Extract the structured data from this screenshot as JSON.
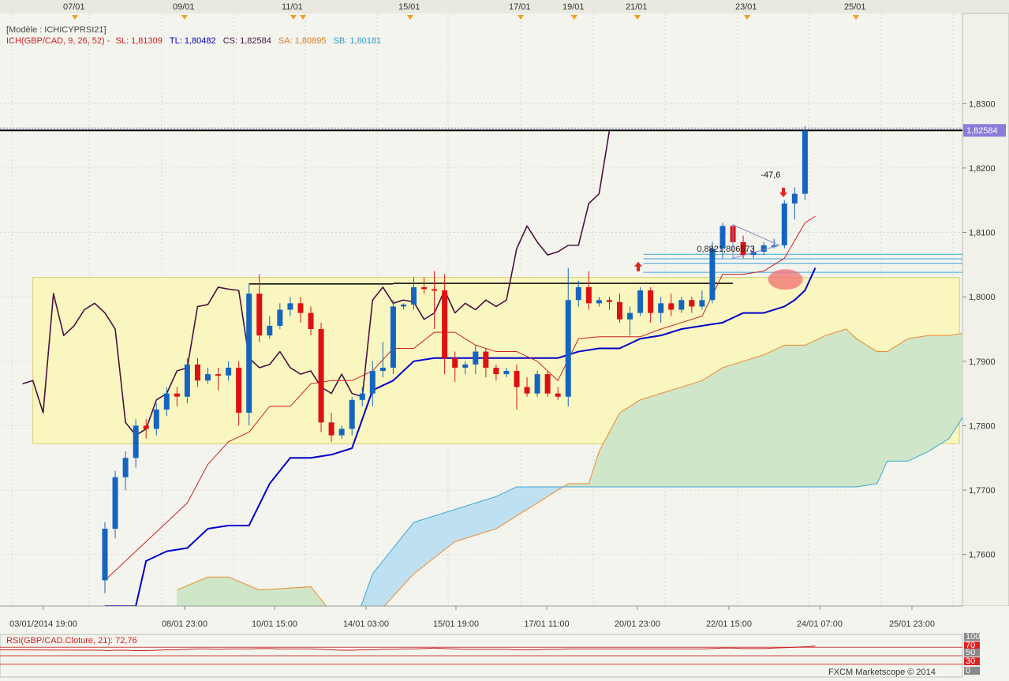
{
  "header": {
    "model_text": "[Modèle : ICHICYPRSI21]",
    "ich_label": "ICH(GBP/CAD, 9, 26, 52) -",
    "sl": "SL: 1,81309",
    "tl": "TL: 1,80482",
    "cs": "CS: 1,82584",
    "sa": "SA: 1,80895",
    "sb": "SB: 1,80181"
  },
  "rsi": {
    "label": "RSI(GBP/CAD.Cloture, 21): 72,76",
    "axis": [
      "100",
      "70",
      "50",
      "30",
      "0"
    ],
    "levels": [
      70,
      50,
      30
    ]
  },
  "footer": {
    "brand": "FXCM Marketscope © 2014"
  },
  "annotations": {
    "pips": "-47,6",
    "levels_text": "0,8821,806573"
  },
  "colors": {
    "background": "#f4f4ee",
    "bull": "#1565c0",
    "bear": "#dd1111",
    "tenkan": "#cc2222",
    "kijun": "#0000cc",
    "chikou": "#4a1040",
    "senkou_a": "#f08a30",
    "senkou_b": "#3aa6d8",
    "kumo_bull": "#bfe0f0",
    "kumo_bear": "#cfe6c8",
    "zone": "#faf6c0",
    "price_tag": "#8a7cdc"
  },
  "chart_data": {
    "type": "candlestick",
    "symbol": "GBP/CAD",
    "last_price": "1,82584",
    "ylim": [
      1.752,
      1.844
    ],
    "yticks": [
      "1,7600",
      "1,7700",
      "1,7800",
      "1,7900",
      "1,8000",
      "1,8100",
      "1,8200",
      "1,8300"
    ],
    "x_labels_bottom": [
      "03/01/2014 19:00",
      "08/01 23:00",
      "10/01 15:00",
      "14/01 03:00",
      "15/01 19:00",
      "17/01 11:00",
      "20/01 23:00",
      "22/01 15:00",
      "24/01 07:00",
      "25/01 23:00"
    ],
    "x_labels_top": [
      "07/01",
      "09/01",
      "11/01",
      "15/01",
      "17/01",
      "19/01",
      "21/01",
      "23/01",
      "25/01"
    ],
    "candles": [
      [
        1.756,
        1.764,
        1.754,
        1.765
      ],
      [
        1.764,
        1.772,
        1.7625,
        1.773
      ],
      [
        1.772,
        1.775,
        1.77,
        1.776
      ],
      [
        1.775,
        1.78,
        1.7735,
        1.781
      ],
      [
        1.78,
        1.7795,
        1.778,
        1.781
      ],
      [
        1.7795,
        1.7825,
        1.7785,
        1.7835
      ],
      [
        1.7825,
        1.785,
        1.7815,
        1.786
      ],
      [
        1.785,
        1.7845,
        1.783,
        1.786
      ],
      [
        1.7845,
        1.7895,
        1.7835,
        1.7905
      ],
      [
        1.7895,
        1.787,
        1.786,
        1.7905
      ],
      [
        1.787,
        1.788,
        1.7865,
        1.789
      ],
      [
        1.788,
        1.7878,
        1.7855,
        1.789
      ],
      [
        1.7878,
        1.789,
        1.787,
        1.79
      ],
      [
        1.789,
        1.782,
        1.78,
        1.79
      ],
      [
        1.782,
        1.8005,
        1.78,
        1.802
      ],
      [
        1.8005,
        1.794,
        1.793,
        1.8035
      ],
      [
        1.794,
        1.7955,
        1.7935,
        1.797
      ],
      [
        1.7955,
        1.798,
        1.795,
        1.799
      ],
      [
        1.798,
        1.799,
        1.797,
        1.8
      ],
      [
        1.799,
        1.7975,
        1.796,
        1.8
      ],
      [
        1.7975,
        1.795,
        1.794,
        1.7985
      ],
      [
        1.795,
        1.7805,
        1.779,
        1.796
      ],
      [
        1.7805,
        1.7785,
        1.7775,
        1.782
      ],
      [
        1.7785,
        1.7795,
        1.778,
        1.78
      ],
      [
        1.7795,
        1.784,
        1.7785,
        1.7845
      ],
      [
        1.784,
        1.785,
        1.783,
        1.786
      ],
      [
        1.785,
        1.7885,
        1.783,
        1.79
      ],
      [
        1.7885,
        1.789,
        1.7875,
        1.793
      ],
      [
        1.789,
        1.7985,
        1.788,
        1.7995
      ],
      [
        1.7985,
        1.7988,
        1.798,
        1.799
      ],
      [
        1.7988,
        1.8015,
        1.798,
        1.803
      ],
      [
        1.8015,
        1.8012,
        1.8005,
        1.803
      ],
      [
        1.8012,
        1.801,
        1.795,
        1.804
      ],
      [
        1.801,
        1.7905,
        1.788,
        1.8035
      ],
      [
        1.7905,
        1.789,
        1.7868,
        1.7915
      ],
      [
        1.789,
        1.7895,
        1.788,
        1.79
      ],
      [
        1.7895,
        1.7915,
        1.788,
        1.7925
      ],
      [
        1.7915,
        1.789,
        1.7875,
        1.792
      ],
      [
        1.789,
        1.788,
        1.787,
        1.7895
      ],
      [
        1.788,
        1.7885,
        1.7875,
        1.789
      ],
      [
        1.7885,
        1.786,
        1.7825,
        1.7895
      ],
      [
        1.786,
        1.785,
        1.7845,
        1.7875
      ],
      [
        1.785,
        1.788,
        1.7845,
        1.7885
      ],
      [
        1.788,
        1.785,
        1.7845,
        1.7885
      ],
      [
        1.785,
        1.7845,
        1.784,
        1.786
      ],
      [
        1.7845,
        1.7995,
        1.783,
        1.8045
      ],
      [
        1.7995,
        1.8015,
        1.7985,
        1.8025
      ],
      [
        1.8015,
        1.799,
        1.798,
        1.804
      ],
      [
        1.799,
        1.7995,
        1.7985,
        1.8
      ],
      [
        1.7995,
        1.7992,
        1.798,
        1.8
      ],
      [
        1.7992,
        1.7965,
        1.796,
        1.8005
      ],
      [
        1.7965,
        1.7975,
        1.794,
        1.7985
      ],
      [
        1.7975,
        1.801,
        1.797,
        1.8015
      ],
      [
        1.801,
        1.7975,
        1.796,
        1.8015
      ],
      [
        1.7975,
        1.799,
        1.796,
        1.8
      ],
      [
        1.799,
        1.798,
        1.797,
        1.8005
      ],
      [
        1.798,
        1.7995,
        1.7975,
        1.8
      ],
      [
        1.7995,
        1.7985,
        1.7975,
        1.8
      ],
      [
        1.7985,
        1.7995,
        1.798,
        1.801
      ],
      [
        1.7995,
        1.8075,
        1.799,
        1.8085
      ],
      [
        1.8075,
        1.811,
        1.806,
        1.8115
      ],
      [
        1.811,
        1.8085,
        1.8075,
        1.8112
      ],
      [
        1.8085,
        1.8065,
        1.806,
        1.8095
      ],
      [
        1.8065,
        1.807,
        1.806,
        1.808
      ],
      [
        1.807,
        1.808,
        1.8065,
        1.8085
      ],
      [
        1.808,
        1.808,
        1.8075,
        1.809
      ],
      [
        1.808,
        1.8145,
        1.8075,
        1.815
      ],
      [
        1.8145,
        1.816,
        1.812,
        1.817
      ],
      [
        1.816,
        1.8258,
        1.815,
        1.8265
      ]
    ],
    "tenkan": [
      [
        0,
        1.756
      ],
      [
        4,
        1.762
      ],
      [
        8,
        1.768
      ],
      [
        10,
        1.774
      ],
      [
        12,
        1.7775
      ],
      [
        14,
        1.779
      ],
      [
        16,
        1.783
      ],
      [
        18,
        1.783
      ],
      [
        20,
        1.7865
      ],
      [
        22,
        1.787
      ],
      [
        24,
        1.787
      ],
      [
        26,
        1.7885
      ],
      [
        28,
        1.792
      ],
      [
        30,
        1.792
      ],
      [
        32,
        1.7945
      ],
      [
        34,
        1.7945
      ],
      [
        36,
        1.7925
      ],
      [
        38,
        1.7915
      ],
      [
        40,
        1.7915
      ],
      [
        42,
        1.79
      ],
      [
        44,
        1.787
      ],
      [
        46,
        1.7935
      ],
      [
        48,
        1.7938
      ],
      [
        50,
        1.7938
      ],
      [
        52,
        1.7938
      ],
      [
        54,
        1.795
      ],
      [
        56,
        1.796
      ],
      [
        58,
        1.797
      ],
      [
        60,
        1.8035
      ],
      [
        62,
        1.8035
      ],
      [
        64,
        1.804
      ],
      [
        66,
        1.806
      ],
      [
        68,
        1.8115
      ],
      [
        69,
        1.8125
      ]
    ],
    "kijun": [
      [
        0,
        1.752
      ],
      [
        3,
        1.752
      ],
      [
        4,
        1.759
      ],
      [
        6,
        1.7605
      ],
      [
        8,
        1.761
      ],
      [
        10,
        1.764
      ],
      [
        12,
        1.7645
      ],
      [
        14,
        1.7645
      ],
      [
        16,
        1.771
      ],
      [
        18,
        1.775
      ],
      [
        20,
        1.775
      ],
      [
        22,
        1.7755
      ],
      [
        24,
        1.7765
      ],
      [
        26,
        1.7855
      ],
      [
        28,
        1.787
      ],
      [
        30,
        1.79
      ],
      [
        32,
        1.7905
      ],
      [
        34,
        1.7905
      ],
      [
        44,
        1.7905
      ],
      [
        46,
        1.7915
      ],
      [
        48,
        1.792
      ],
      [
        50,
        1.792
      ],
      [
        52,
        1.7935
      ],
      [
        54,
        1.794
      ],
      [
        56,
        1.795
      ],
      [
        58,
        1.7955
      ],
      [
        60,
        1.796
      ],
      [
        62,
        1.7975
      ],
      [
        64,
        1.7975
      ],
      [
        66,
        1.7985
      ],
      [
        67,
        1.7995
      ],
      [
        68,
        1.801
      ],
      [
        69,
        1.8045
      ]
    ],
    "chikou": [
      [
        -8,
        1.7865
      ],
      [
        -7,
        1.787
      ],
      [
        -6,
        1.782
      ],
      [
        -5,
        1.8005
      ],
      [
        -4,
        1.794
      ],
      [
        -3,
        1.7955
      ],
      [
        -2,
        1.798
      ],
      [
        -1,
        1.799
      ],
      [
        0,
        1.7975
      ],
      [
        1,
        1.795
      ],
      [
        2,
        1.7805
      ],
      [
        3,
        1.7785
      ],
      [
        4,
        1.7795
      ],
      [
        5,
        1.784
      ],
      [
        6,
        1.785
      ],
      [
        7,
        1.7885
      ],
      [
        8,
        1.789
      ],
      [
        9,
        1.7985
      ],
      [
        10,
        1.7988
      ],
      [
        11,
        1.8015
      ],
      [
        12,
        1.8012
      ],
      [
        13,
        1.801
      ],
      [
        14,
        1.7905
      ],
      [
        15,
        1.789
      ],
      [
        16,
        1.7895
      ],
      [
        17,
        1.7915
      ],
      [
        18,
        1.789
      ],
      [
        19,
        1.788
      ],
      [
        20,
        1.7885
      ],
      [
        21,
        1.786
      ],
      [
        22,
        1.785
      ],
      [
        23,
        1.788
      ],
      [
        24,
        1.785
      ],
      [
        25,
        1.7845
      ],
      [
        26,
        1.7995
      ],
      [
        27,
        1.8015
      ],
      [
        28,
        1.799
      ],
      [
        29,
        1.7995
      ],
      [
        30,
        1.7992
      ],
      [
        31,
        1.7965
      ],
      [
        32,
        1.7975
      ],
      [
        33,
        1.801
      ],
      [
        34,
        1.7975
      ],
      [
        35,
        1.799
      ],
      [
        36,
        1.798
      ],
      [
        37,
        1.7995
      ],
      [
        38,
        1.7985
      ],
      [
        39,
        1.7995
      ],
      [
        40,
        1.8075
      ],
      [
        41,
        1.811
      ],
      [
        42,
        1.8085
      ],
      [
        43,
        1.8065
      ],
      [
        44,
        1.807
      ],
      [
        45,
        1.808
      ],
      [
        46,
        1.808
      ],
      [
        47,
        1.8145
      ],
      [
        48,
        1.816
      ],
      [
        49,
        1.8258
      ]
    ],
    "senkou_a": [
      [
        7,
        1.7545
      ],
      [
        10,
        1.7565
      ],
      [
        12,
        1.7565
      ],
      [
        15,
        1.7545
      ],
      [
        20,
        1.755
      ],
      [
        24,
        1.747
      ],
      [
        26,
        1.75
      ],
      [
        30,
        1.757
      ],
      [
        34,
        1.762
      ],
      [
        38,
        1.764
      ],
      [
        42,
        1.768
      ],
      [
        45,
        1.771
      ],
      [
        47,
        1.771
      ],
      [
        48,
        1.776
      ],
      [
        50,
        1.782
      ],
      [
        52,
        1.784
      ],
      [
        54,
        1.785
      ],
      [
        56,
        1.786
      ],
      [
        58,
        1.787
      ],
      [
        60,
        1.789
      ],
      [
        62,
        1.79
      ],
      [
        64,
        1.791
      ],
      [
        66,
        1.7925
      ],
      [
        68,
        1.7925
      ],
      [
        70,
        1.794
      ],
      [
        72,
        1.795
      ],
      [
        73,
        1.7935
      ],
      [
        75,
        1.7915
      ],
      [
        76,
        1.7915
      ],
      [
        78,
        1.7935
      ],
      [
        80,
        1.794
      ],
      [
        82,
        1.794
      ],
      [
        84,
        1.7945
      ],
      [
        86,
        1.7955
      ],
      [
        88,
        1.796
      ],
      [
        90,
        1.801
      ],
      [
        92,
        1.8025
      ],
      [
        94,
        1.803
      ],
      [
        96,
        1.803
      ],
      [
        98,
        1.8035
      ],
      [
        100,
        1.806
      ]
    ],
    "senkou_b": [
      [
        7,
        1.752
      ],
      [
        10,
        1.752
      ],
      [
        12,
        1.752
      ],
      [
        15,
        1.752
      ],
      [
        20,
        1.752
      ],
      [
        24,
        1.748
      ],
      [
        26,
        1.757
      ],
      [
        28,
        1.761
      ],
      [
        30,
        1.765
      ],
      [
        34,
        1.767
      ],
      [
        38,
        1.769
      ],
      [
        40,
        1.7705
      ],
      [
        45,
        1.7705
      ],
      [
        50,
        1.7705
      ],
      [
        55,
        1.7705
      ],
      [
        60,
        1.7705
      ],
      [
        65,
        1.7705
      ],
      [
        70,
        1.7705
      ],
      [
        73,
        1.7705
      ],
      [
        75,
        1.771
      ],
      [
        76,
        1.7745
      ],
      [
        78,
        1.7745
      ],
      [
        80,
        1.776
      ],
      [
        82,
        1.778
      ],
      [
        84,
        1.783
      ],
      [
        86,
        1.7845
      ],
      [
        88,
        1.788
      ],
      [
        90,
        1.7885
      ],
      [
        92,
        1.79
      ],
      [
        94,
        1.7925
      ],
      [
        96,
        1.794
      ],
      [
        98,
        1.794
      ],
      [
        100,
        1.7965
      ]
    ],
    "zone_box": {
      "x_range": [
        -7,
        83
      ],
      "y_range": [
        1.7772,
        1.803
      ]
    },
    "horizontal_lines": [
      {
        "x_range": [
          14,
          28
        ],
        "y": 1.802
      },
      {
        "x_range": [
          28,
          61
        ],
        "y": 1.8021
      }
    ],
    "fib_levels": [
      1.8066,
      1.8059,
      1.8052,
      1.8038
    ],
    "rsi_values": [
      62,
      63,
      63,
      62,
      62,
      63,
      64,
      64,
      65,
      66,
      66,
      65,
      66,
      66,
      66,
      67,
      67,
      66,
      66,
      66,
      66,
      65,
      64,
      63,
      63,
      64,
      64,
      65,
      65,
      66,
      66,
      67,
      68,
      67,
      66,
      65,
      65,
      65,
      65,
      65,
      64,
      64,
      64,
      65,
      65,
      66,
      66,
      66,
      66,
      66,
      66,
      66,
      66,
      66,
      66,
      66,
      66,
      66,
      66,
      67,
      68,
      68,
      67,
      67,
      67,
      68,
      69,
      70,
      71,
      72.76
    ]
  }
}
